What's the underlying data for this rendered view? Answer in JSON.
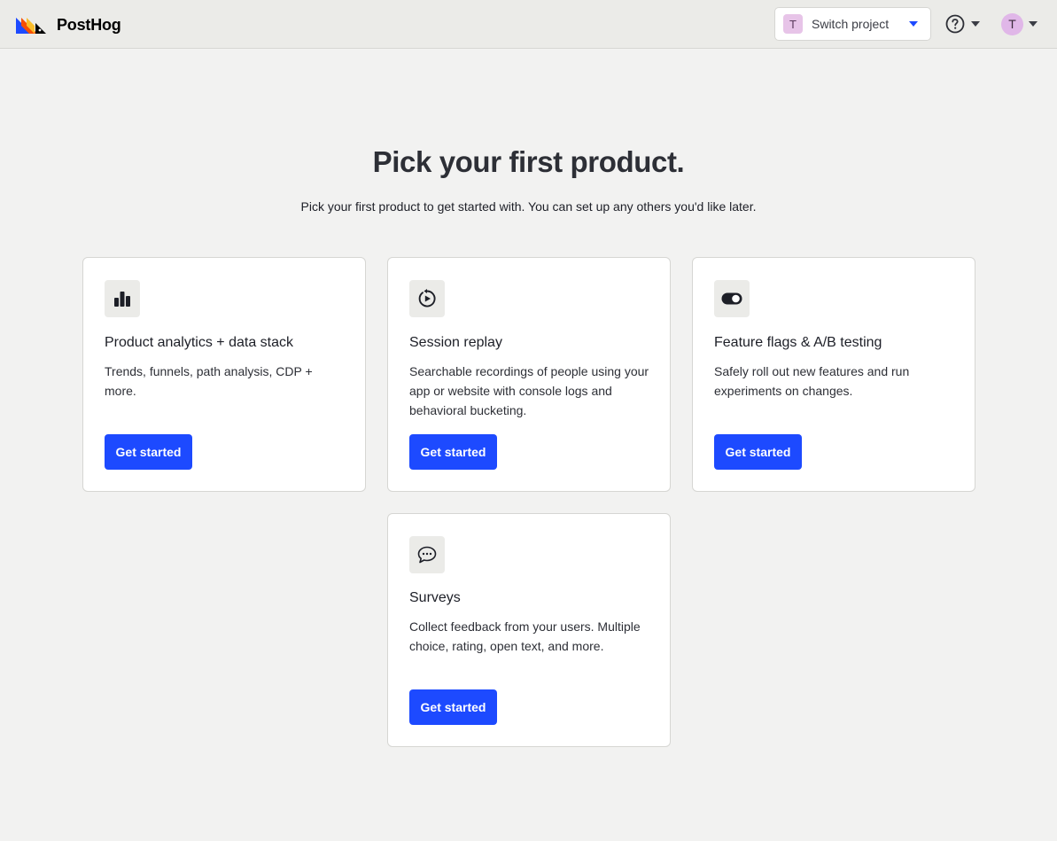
{
  "header": {
    "brand": "PostHog",
    "project_initial": "T",
    "project_switch_label": "Switch project",
    "user_initial": "T"
  },
  "main": {
    "title": "Pick your first product.",
    "subtitle": "Pick your first product to get started with. You can set up any others you'd like later."
  },
  "products": [
    {
      "icon": "bar-chart-icon",
      "title": "Product analytics + data stack",
      "description": "Trends, funnels, path analysis, CDP + more.",
      "button": "Get started"
    },
    {
      "icon": "replay-icon",
      "title": "Session replay",
      "description": "Searchable recordings of people using your app or website with console logs and behavioral bucketing.",
      "button": "Get started"
    },
    {
      "icon": "toggle-icon",
      "title": "Feature flags & A/B testing",
      "description": "Safely roll out new features and run experiments on changes.",
      "button": "Get started"
    },
    {
      "icon": "chat-bubble-icon",
      "title": "Surveys",
      "description": "Collect feedback from your users. Multiple choice, rating, open text, and more.",
      "button": "Get started"
    }
  ],
  "colors": {
    "accent": "#1d4aff",
    "background": "#f2f2f1",
    "topbar": "#ebebe8"
  }
}
